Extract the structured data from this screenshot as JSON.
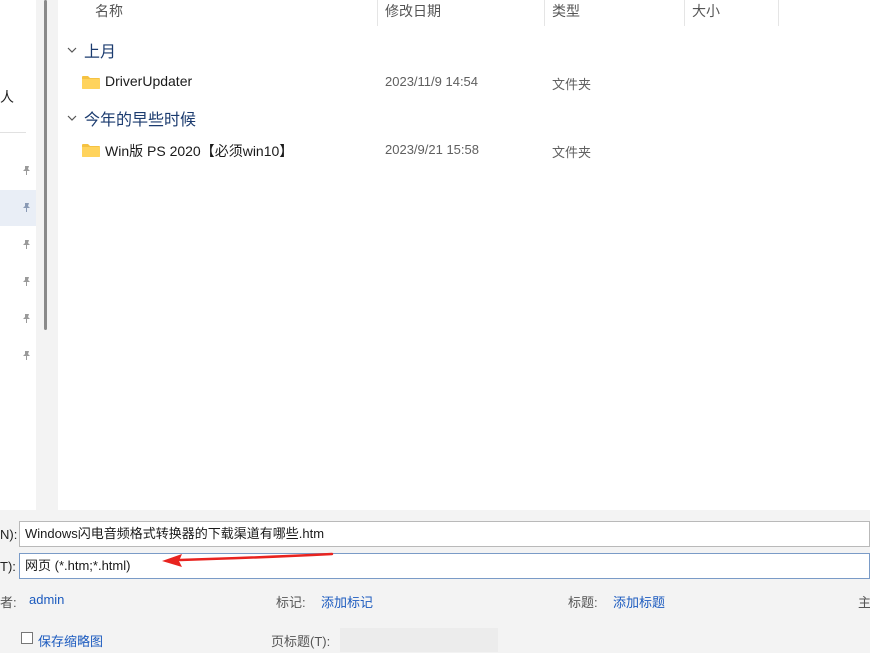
{
  "columns": {
    "name": "名称",
    "modified": "修改日期",
    "type": "类型",
    "size": "大小"
  },
  "nav": {
    "partial_label": "人"
  },
  "groups": [
    {
      "label": "上月",
      "items": [
        {
          "name": "DriverUpdater",
          "date": "2023/11/9 14:54",
          "type": "文件夹"
        }
      ]
    },
    {
      "label": "今年的早些时候",
      "items": [
        {
          "name": "Win版 PS 2020【必须win10】",
          "date": "2023/9/21 15:58",
          "type": "文件夹"
        }
      ]
    }
  ],
  "save": {
    "filename_label": "N):",
    "filename_value": "Windows闪电音频格式转换器的下载渠道有哪些.htm",
    "filetype_label": "T):",
    "filetype_value": "网页 (*.htm;*.html)",
    "author_label": "者:",
    "author_value": "admin",
    "tags_label": "标记:",
    "tags_value": "添加标记",
    "title_label": "标题:",
    "title_value": "添加标题",
    "subject_partial": "主",
    "thumbnail_label": "保存缩略图",
    "page_title_label": "页标题(T):",
    "page_title_value": ""
  },
  "colors": {
    "accent": "#1c5bbf",
    "group_text": "#1b3b6f",
    "arrow": "#e8231f",
    "folder": "#f5c242"
  }
}
